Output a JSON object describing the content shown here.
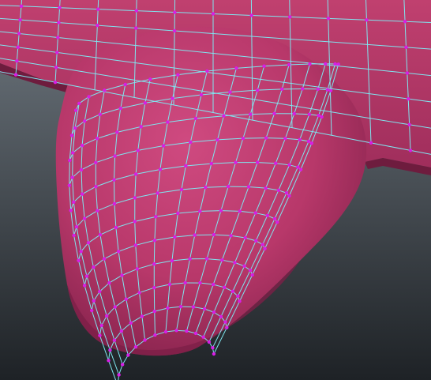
{
  "viewport": {
    "background_top": "#6f7880",
    "background_bottom": "#1e2226",
    "mesh_fill": "#b8386a",
    "mesh_shadow": "#7d1f47",
    "mesh_highlight": "#cf4a80",
    "wire_color": "#7fe6f0",
    "vertex_color": "#d81ee6"
  }
}
